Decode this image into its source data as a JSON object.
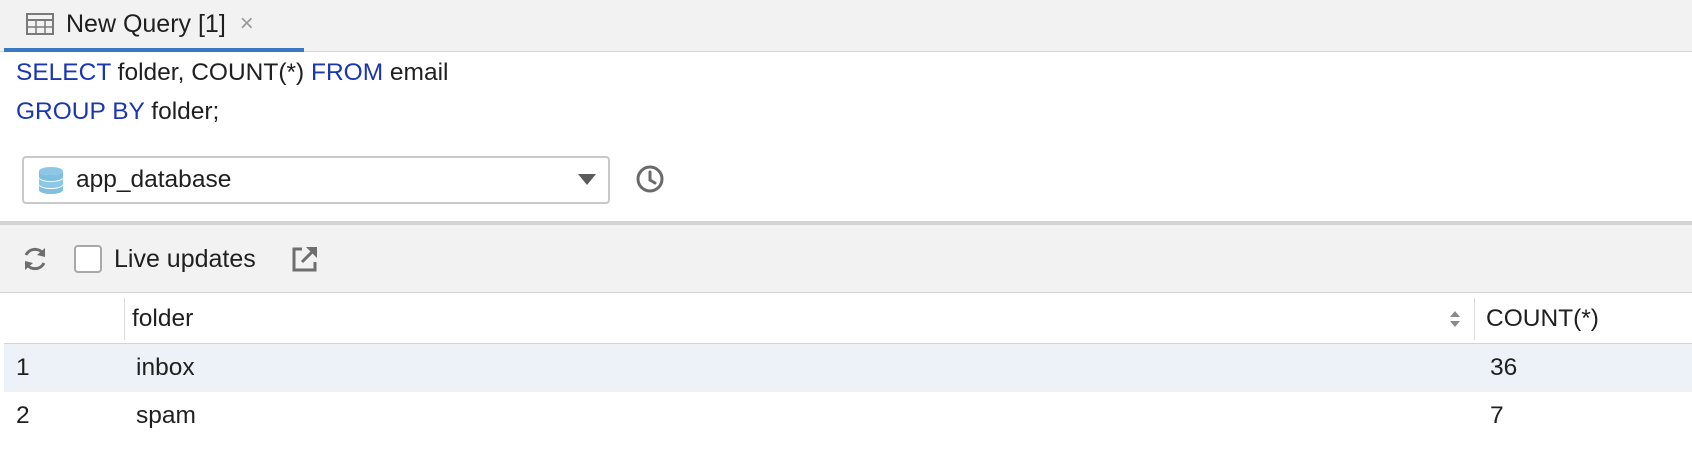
{
  "tab": {
    "label": "New Query [1]",
    "close": "×"
  },
  "editor": {
    "line1": {
      "kw1": "SELECT",
      "t1": " folder, COUNT(*) ",
      "kw2": "FROM",
      "t2": " email"
    },
    "line2": {
      "kw1": "GROUP BY",
      "t1": " folder;"
    }
  },
  "database": {
    "selected": "app_database"
  },
  "toolbar": {
    "live_updates_label": "Live updates",
    "live_updates_checked": false
  },
  "grid": {
    "columns": [
      "folder",
      "COUNT(*)"
    ],
    "rows": [
      {
        "index": "1",
        "folder": "inbox",
        "count": "36"
      },
      {
        "index": "2",
        "folder": "spam",
        "count": "7"
      }
    ]
  },
  "colors": {
    "keyword": "#1a37b0",
    "tab_accent": "#3a78c4",
    "selected_row": "#edf2f9",
    "db_icon": "#7fbfe0"
  },
  "icons": [
    "table-icon",
    "database-icon",
    "history-icon",
    "refresh-icon",
    "export-icon",
    "sort-icon"
  ]
}
